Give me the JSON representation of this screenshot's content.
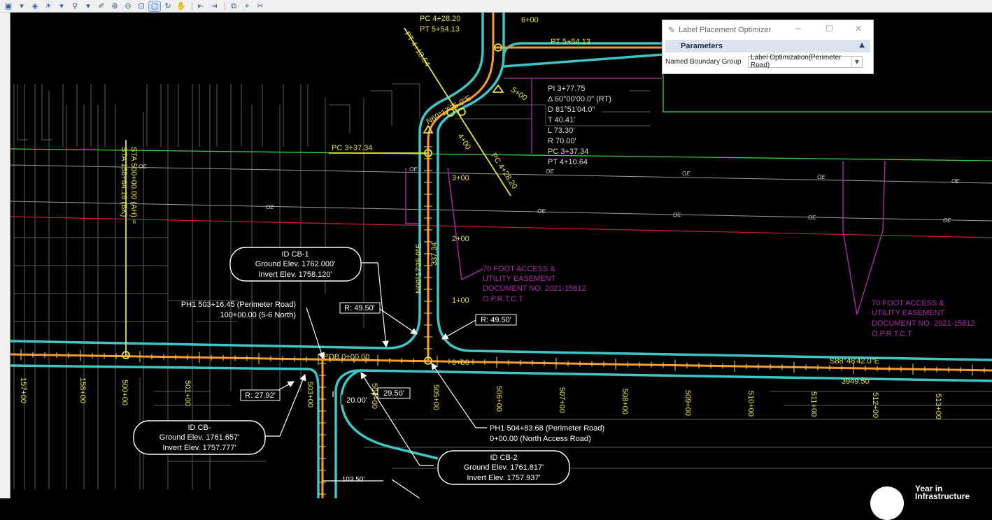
{
  "toolbar": {
    "icons": [
      "view-rotate-icon",
      "dropdown-arrow-icon",
      "display-style-icon",
      "lighting-icon",
      "dropdown-arrow-icon",
      "place-marker-icon",
      "dropdown-arrow-icon",
      "brush-icon",
      "zoom-in-icon",
      "zoom-out-icon",
      "window-area-icon",
      "fit-view-icon",
      "rotate-icon",
      "pan-icon",
      "previous-view-icon",
      "next-view-icon",
      "copy-view-icon",
      "measure-icon",
      "clip-icon"
    ]
  },
  "dialog": {
    "title": "Label Placement Optimizer",
    "section": "Parameters",
    "field_label": "Named Boundary Group",
    "field_value": "Label Optimization(Perimeter Road)"
  },
  "drawing": {
    "top_labels": {
      "pc_428": "PC 4+28.20",
      "pt_554_top": "PT 5+54.13",
      "sta_600": "6+00",
      "pt_554_right": "PT 5+54.13",
      "pt_410_diag": "PT 4+10.64",
      "sta_500": "5+00"
    },
    "curve_data": [
      "PI 3+77.75",
      "Δ 60°00'00.0\" (RT)",
      "D 81°51'04.0\"",
      "T 40.41'",
      "L 73.30'",
      "R 70.00'",
      "PC 3+37.34",
      "PT 4+10.64"
    ],
    "bearing_diag": "N60°17'25.0\"E",
    "sta_400_diag": "4+00",
    "pc_428_diag": "PC 4+28.20",
    "pc_337": "PC 3+37.34",
    "sta_300": "3+00",
    "sta_200": "2+00",
    "sta_100": "1+00",
    "vertical_bearing": "N00°17'25.0\"E",
    "length_337": "337.34",
    "sta_vertical_1": "STA 500+00.00 (AH) =",
    "sta_vertical_2": "STA 158+64.18 (BK)",
    "oe": "OE",
    "easement_1": [
      "70 FOOT ACCESS &",
      "UTILITY EASEMENT",
      "DOCUMENT NO. 2021-15812",
      "O.P.R.T.C.T"
    ],
    "easement_2": [
      "70 FOOT ACCESS &",
      "UTILITY EASEMENT",
      "DOCUMENT NO. 2021-15812",
      "O.P.R.T.C.T"
    ],
    "cb1": [
      "ID CB-1",
      "Ground Elev. 1762.000'",
      "Invert Elev. 1758.120'"
    ],
    "cb_left": [
      "ID CB-",
      "Ground Elev. 1761.657'",
      "Invert Elev. 1757.777'"
    ],
    "cb2": [
      "ID CB-2",
      "Ground Elev. 1761.817'",
      "Invert Elev. 1757.937'"
    ],
    "ph1_a": [
      "PH1 503+16.45 (Perimeter Road)",
      "100+00.00 (5-6 North)"
    ],
    "ph1_b": [
      "PH1 504+83.68 (Perimeter Road)",
      "0+00.00 (North Access Road)"
    ],
    "r_4950_a": "R: 49.50'",
    "r_4950_b": "R: 49.50'",
    "r_2792": "R: 27.92'",
    "r_2950": "29.50'",
    "dim_2000": "20.00'",
    "dim_10350": "103.50'",
    "pob": "POB 0+00.00",
    "sta_000": "0+00",
    "bearing_road": "S88°48'42.0\"E",
    "dist_road": "3949.50",
    "stations": [
      "157+00",
      "158+00",
      "500+00",
      "501+00",
      "503+00",
      "504+00",
      "505+00",
      "506+00",
      "507+00",
      "508+00",
      "509+00",
      "510+00",
      "511+00",
      "512+00",
      "513+00"
    ]
  },
  "watermark": {
    "line1": "Year in",
    "line2": "Infrastructure"
  },
  "colors": {
    "yellow": "#e8e23a",
    "cyan": "#3ec6c6",
    "orange": "#ff9a2e",
    "green": "#3ccf3c",
    "magenta": "#b02aa8",
    "red": "#c01a3a",
    "white": "#ffffff",
    "grey": "#8a8a8a"
  }
}
